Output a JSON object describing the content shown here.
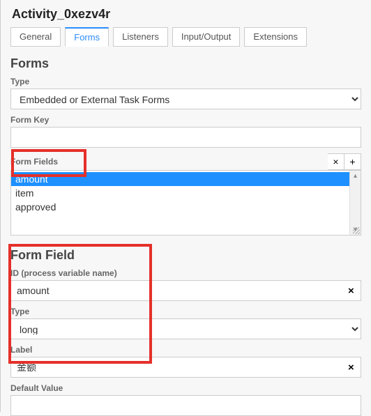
{
  "header": {
    "title": "Activity_0xezv4r"
  },
  "tabs": {
    "items": [
      {
        "label": "General",
        "active": false
      },
      {
        "label": "Forms",
        "active": true
      },
      {
        "label": "Listeners",
        "active": false
      },
      {
        "label": "Input/Output",
        "active": false
      },
      {
        "label": "Extensions",
        "active": false
      }
    ]
  },
  "forms": {
    "heading": "Forms",
    "type_label": "Type",
    "type_value": "Embedded or External Task Forms",
    "form_key_label": "Form Key",
    "form_key_value": "",
    "form_fields_label": "Form Fields",
    "remove_icon": "×",
    "add_icon": "+",
    "fields": [
      {
        "label": "amount",
        "selected": true
      },
      {
        "label": "item",
        "selected": false
      },
      {
        "label": "approved",
        "selected": false
      }
    ]
  },
  "form_field": {
    "heading": "Form Field",
    "id_label": "ID (process variable name)",
    "id_value": "amount",
    "type_label": "Type",
    "type_value": "long",
    "label_label": "Label",
    "label_value": "金额",
    "default_value_label": "Default Value",
    "default_value_value": "",
    "clear_icon": "×"
  }
}
